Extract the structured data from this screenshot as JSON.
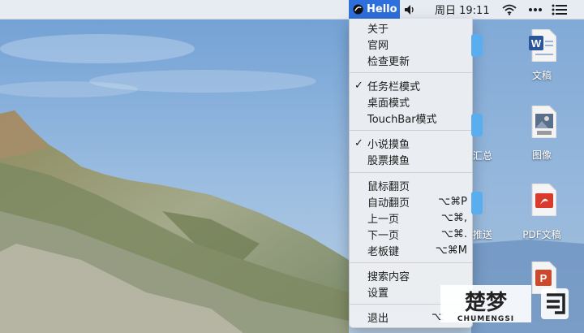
{
  "menubar": {
    "app_title": "Hello",
    "app_logo_icon": "hello-app-icon",
    "volume_icon": "speaker-icon",
    "clock": "周日 19:11",
    "wifi_icon": "wifi-icon",
    "more_icon": "ellipsis-icon",
    "list_icon": "control-center-icon"
  },
  "menu": {
    "about": "关于",
    "website": "官网",
    "check_update": "检查更新",
    "taskbar_mode": "任务栏模式",
    "desktop_mode": "桌面模式",
    "touchbar_mode": "TouchBar模式",
    "novel_mode": "小说摸鱼",
    "stock_mode": "股票摸鱼",
    "mouse_page": "鼠标翻页",
    "auto_page": "自动翻页",
    "auto_page_shortcut": "⌥⌘P",
    "prev_page": "上一页",
    "prev_page_shortcut": "⌥⌘,",
    "next_page": "下一页",
    "next_page_shortcut": "⌥⌘.",
    "boss_key": "老板键",
    "boss_key_shortcut": "⌥⌘M",
    "search_content": "搜索内容",
    "settings": "设置",
    "quit": "退出",
    "quit_shortcut": "⌥",
    "checkmark": "✓"
  },
  "desktop": {
    "files": [
      {
        "name": "文稿",
        "icon": "word-document-icon"
      },
      {
        "name": "图像",
        "icon": "jpeg-image-icon"
      },
      {
        "name": "PDF文稿",
        "icon": "pdf-document-icon"
      },
      {
        "name": "",
        "icon": "powerpoint-document-icon"
      }
    ],
    "partial_labels": [
      "汇总",
      "推送"
    ]
  },
  "watermark": {
    "title": "楚梦",
    "subtitle": "CHUMENGSI"
  },
  "colors": {
    "accent": "#2d6fdc",
    "menu_bg": "#eceef2",
    "folder": "#5aaef0"
  }
}
